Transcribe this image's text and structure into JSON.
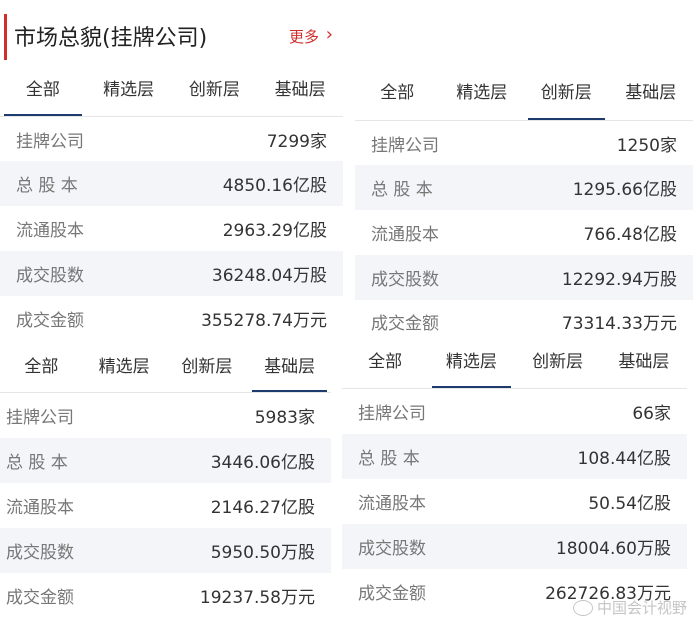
{
  "header": {
    "title": "市场总貌(挂牌公司)",
    "more": "更多"
  },
  "tabs": [
    "全部",
    "精选层",
    "创新层",
    "基础层"
  ],
  "panels": {
    "all": {
      "active_tab": "全部",
      "rows": [
        {
          "label": "挂牌公司",
          "value": "7299家"
        },
        {
          "label": "总 股 本",
          "value": "4850.16亿股"
        },
        {
          "label": "流通股本",
          "value": "2963.29亿股"
        },
        {
          "label": "成交股数",
          "value": "36248.04万股"
        },
        {
          "label": "成交金额",
          "value": "355278.74万元"
        }
      ]
    },
    "innovation": {
      "active_tab": "创新层",
      "rows": [
        {
          "label": "挂牌公司",
          "value": "1250家"
        },
        {
          "label": "总 股 本",
          "value": "1295.66亿股"
        },
        {
          "label": "流通股本",
          "value": "766.48亿股"
        },
        {
          "label": "成交股数",
          "value": "12292.94万股"
        },
        {
          "label": "成交金额",
          "value": "73314.33万元"
        }
      ]
    },
    "basic": {
      "active_tab": "基础层",
      "rows": [
        {
          "label": "挂牌公司",
          "value": "5983家"
        },
        {
          "label": "总 股 本",
          "value": "3446.06亿股"
        },
        {
          "label": "流通股本",
          "value": "2146.27亿股"
        },
        {
          "label": "成交股数",
          "value": "5950.50万股"
        },
        {
          "label": "成交金额",
          "value": "19237.58万元"
        }
      ]
    },
    "select": {
      "active_tab": "精选层",
      "rows": [
        {
          "label": "挂牌公司",
          "value": "66家"
        },
        {
          "label": "总 股 本",
          "value": "108.44亿股"
        },
        {
          "label": "流通股本",
          "value": "50.54亿股"
        },
        {
          "label": "成交股数",
          "value": "18004.60万股"
        },
        {
          "label": "成交金额",
          "value": "262726.83万元"
        }
      ]
    }
  },
  "watermark": "中国会计视野",
  "colors": {
    "accent_red": "#d12d2d",
    "tab_underline": "#1f3b6e",
    "row_alt": "#f4f5f9"
  }
}
